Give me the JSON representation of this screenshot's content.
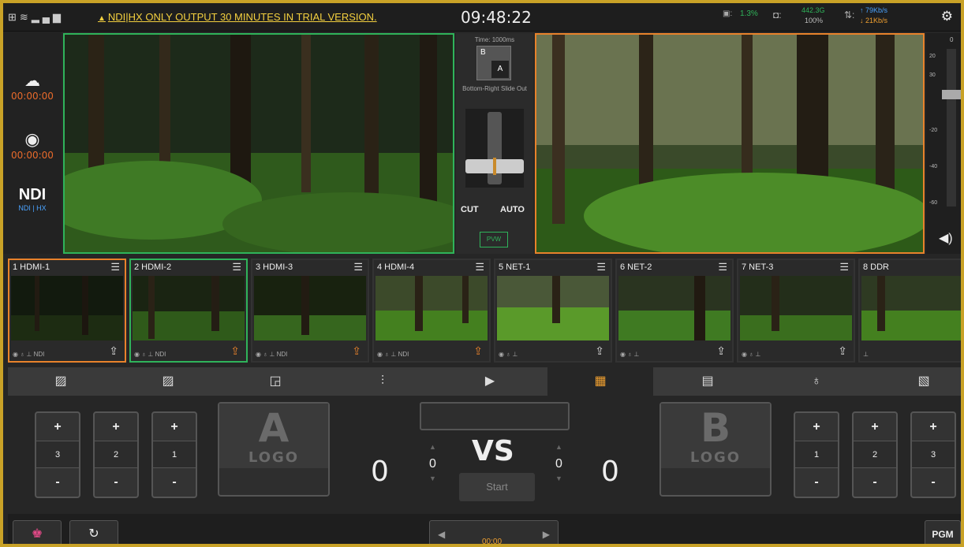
{
  "topbar": {
    "trial_notice": "NDI|HX ONLY OUTPUT 30 MINUTES IN TRIAL VERSION.",
    "clock": "09:48:22",
    "cpu": "1.3%",
    "storage_size": "442.3G",
    "storage_pct": "100%",
    "upload": "79Kb/s",
    "download": "21Kb/s"
  },
  "left": {
    "stream_time": "00:00:00",
    "record_time": "00:00:00",
    "ndi_logo": "NDI",
    "ndi_sub": "NDI | HX"
  },
  "transition": {
    "time": "Time: 1000ms",
    "name": "Bottom-Right Slide Out",
    "cut_label": "CUT",
    "auto_label": "AUTO",
    "pvw_label": "PVW"
  },
  "meter": {
    "scale": [
      "0",
      "20",
      "30",
      "-20",
      "-40",
      "-60"
    ]
  },
  "sources": [
    {
      "label": "1  HDMI-1",
      "footer": "◉ ♁ ⊥ NDI",
      "state": "program"
    },
    {
      "label": "2  HDMI-2",
      "footer": "◉ ♁ ⊥ NDI",
      "state": "preview"
    },
    {
      "label": "3  HDMI-3",
      "footer": "◉ ♁ ⊥ NDI",
      "state": ""
    },
    {
      "label": "4  HDMI-4",
      "footer": "◉ ♁ ⊥ NDI",
      "state": ""
    },
    {
      "label": "5  NET-1",
      "footer": "◉ ♁ ⊥",
      "state": ""
    },
    {
      "label": "6  NET-2",
      "footer": "◉ ♁ ⊥",
      "state": ""
    },
    {
      "label": "7  NET-3",
      "footer": "◉ ♁ ⊥",
      "state": ""
    },
    {
      "label": "8  DDR",
      "footer": "⊥",
      "state": ""
    }
  ],
  "scoreboard": {
    "team_a": {
      "logo_letter": "A",
      "logo_word": "LOGO",
      "score": "0",
      "steppers": [
        "3",
        "2",
        "1"
      ]
    },
    "team_b": {
      "logo_letter": "B",
      "logo_word": "LOGO",
      "score": "0",
      "steppers": [
        "1",
        "2",
        "3"
      ]
    },
    "vs": "VS",
    "period_a": "0",
    "period_b": "0",
    "start_label": "Start",
    "plus": "+",
    "minus": "-"
  },
  "bottom": {
    "timer": "00:00",
    "pgm_label": "PGM"
  },
  "colors": {
    "program": "#e8822b",
    "preview": "#2fb35a",
    "accent": "#f0a030",
    "trial": "#f4d03f"
  }
}
